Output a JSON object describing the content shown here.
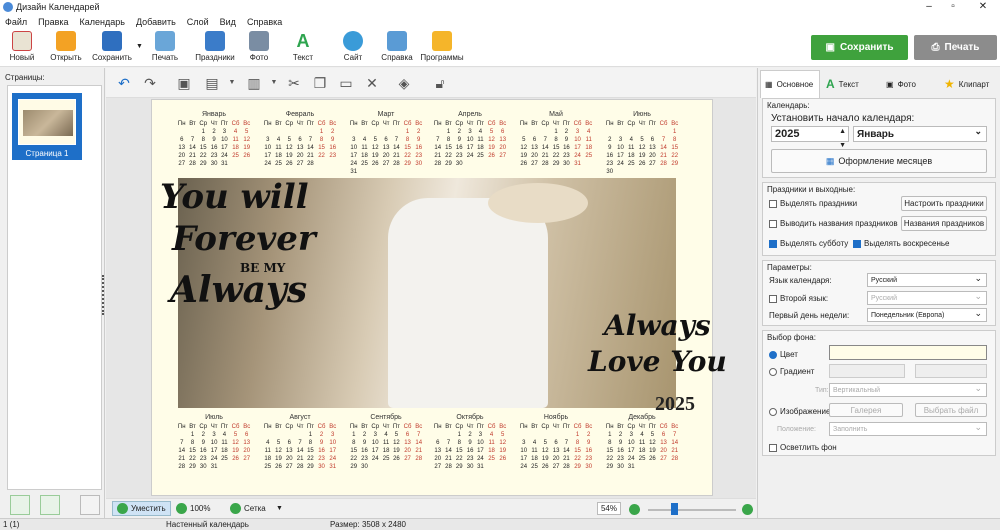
{
  "window": {
    "title": "Дизайн Календарей"
  },
  "menu": [
    "Файл",
    "Правка",
    "Календарь",
    "Добавить",
    "Слой",
    "Вид",
    "Справка"
  ],
  "toolbar": {
    "new": "Новый",
    "open": "Открыть",
    "save": "Сохранить",
    "print": "Печать",
    "holidays": "Праздники",
    "photo": "Фото",
    "text": "Текст",
    "site": "Сайт",
    "help": "Справка",
    "programs": "Программы",
    "save_big": "Сохранить",
    "print_big": "Печать"
  },
  "left": {
    "pages_label": "Страницы:",
    "page1": "Страница 1"
  },
  "calendar": {
    "weekdays": [
      "Пн",
      "Вт",
      "Ср",
      "Чт",
      "Пт",
      "Сб",
      "Вс"
    ],
    "year": "2025",
    "months": [
      {
        "name": "Январь",
        "start": 2,
        "days": 31
      },
      {
        "name": "Февраль",
        "start": 5,
        "days": 28
      },
      {
        "name": "Март",
        "start": 5,
        "days": 31
      },
      {
        "name": "Апрель",
        "start": 1,
        "days": 30
      },
      {
        "name": "Май",
        "start": 3,
        "days": 31
      },
      {
        "name": "Июнь",
        "start": 6,
        "days": 30
      },
      {
        "name": "Июль",
        "start": 1,
        "days": 31
      },
      {
        "name": "Август",
        "start": 4,
        "days": 31
      },
      {
        "name": "Сентябрь",
        "start": 0,
        "days": 30
      },
      {
        "name": "Октябрь",
        "start": 2,
        "days": 31
      },
      {
        "name": "Ноябрь",
        "start": 5,
        "days": 30
      },
      {
        "name": "Декабрь",
        "start": 0,
        "days": 31
      }
    ],
    "lettering_left": [
      "You will",
      "Forever",
      "BE MY",
      "Always"
    ],
    "lettering_right": [
      "Always",
      "Love You"
    ]
  },
  "status": {
    "fit": "Уместить",
    "zoom100": "100%",
    "grid": "Сетка",
    "zoom": "54%",
    "slider_level": 0.3
  },
  "bottom": {
    "pos": "1 (1)",
    "type": "Настенный календарь",
    "size": "Размер: 3508 x 2480"
  },
  "right": {
    "tabs": [
      "Основное",
      "Текст",
      "Фото",
      "Клипарт"
    ],
    "cal_group": "Календарь:",
    "start_label": "Установить начало календаря:",
    "year_value": "2025",
    "month_value": "Январь",
    "months_design": "Оформление месяцев",
    "hol_group": "Праздники и выходные:",
    "highlight_holidays": "Выделять праздники",
    "setup_holidays": "Настроить праздники",
    "show_names": "Выводить названия праздников",
    "holiday_names": "Названия праздников",
    "highlight_sat": "Выделять субботу",
    "highlight_sun": "Выделять воскресенье",
    "params_group": "Параметры:",
    "lang_label": "Язык календаря:",
    "lang_value": "Русский",
    "lang2_label": "Второй язык:",
    "lang2_value": "Русский",
    "weekstart_label": "Первый день недели:",
    "weekstart_value": "Понедельник (Европа)",
    "bg_group": "Выбор фона:",
    "color": "Цвет",
    "color_value": "#fffde8",
    "gradient": "Градиент",
    "type_label": "Тип:",
    "type_value": "Вертикальный",
    "image": "Изображение",
    "gallery": "Галерея",
    "choose_file": "Выбрать файл",
    "position_label": "Положение:",
    "position_value": "Заполнить",
    "lighten": "Осветлить фон"
  }
}
